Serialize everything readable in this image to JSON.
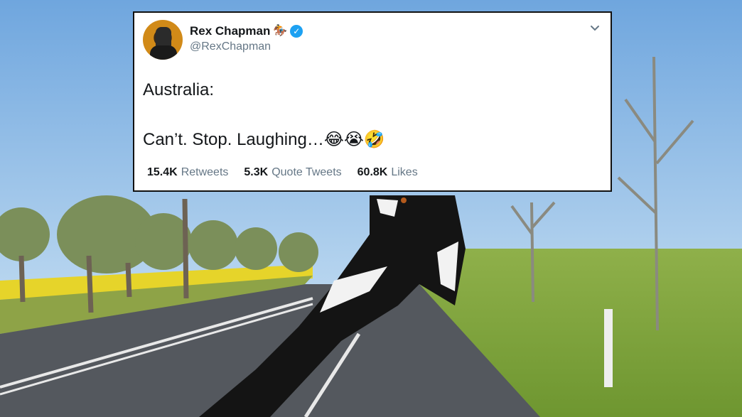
{
  "tweet": {
    "display_name": "Rex Chapman",
    "name_emoji": "🏇",
    "handle": "@RexChapman",
    "text": "Australia:\n\nCan’t. Stop. Laughing…😂😭🤣",
    "stats": [
      {
        "count": "15.4K",
        "label": "Retweets"
      },
      {
        "count": "5.3K",
        "label": "Quote Tweets"
      },
      {
        "count": "60.8K",
        "label": "Likes"
      }
    ]
  },
  "colors": {
    "verified": "#1da1f2",
    "secondary_text": "#657786",
    "primary_text": "#14171a"
  },
  "icons": [
    "verified-badge-icon",
    "chevron-down-icon",
    "horse-racing-emoji"
  ]
}
